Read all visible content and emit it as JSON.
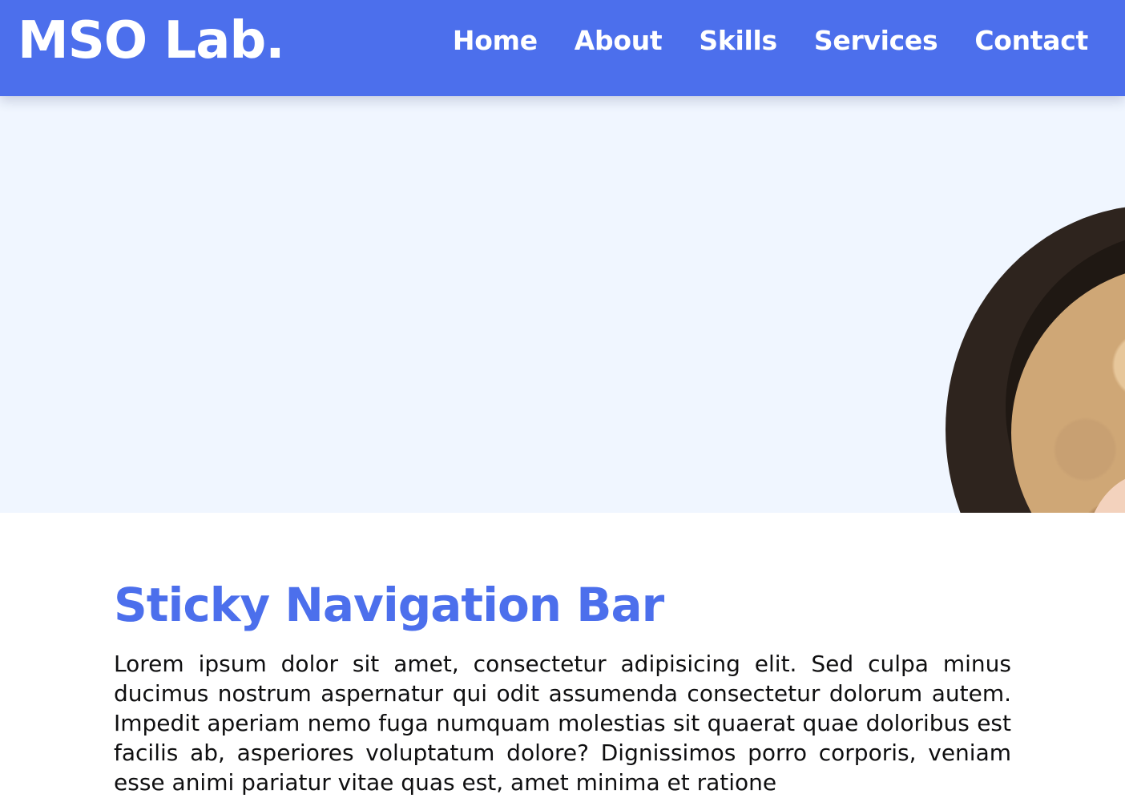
{
  "brand": {
    "logo_text": "MSO Lab."
  },
  "nav": {
    "items": [
      {
        "label": "Home"
      },
      {
        "label": "About"
      },
      {
        "label": "Skills"
      },
      {
        "label": "Services"
      },
      {
        "label": "Contact"
      }
    ]
  },
  "main": {
    "title": "Sticky Navigation Bar",
    "paragraph": "Lorem ipsum dolor sit amet, consectetur adipisicing elit. Sed culpa minus ducimus nostrum aspernatur qui odit assumenda consectetur dolorum autem. Impedit aperiam nemo fuga numquam molestias sit quaerat quae doloribus est facilis ab, asperiores voluptatum dolore? Dignissimos porro corporis, veniam esse animi pariatur vitae quas est, amet minima et ratione"
  },
  "colors": {
    "nav_background": "#4c6fec",
    "hero_background": "#f0f6ff",
    "title_accent": "#4c6fec",
    "nav_text": "#ffffff"
  }
}
